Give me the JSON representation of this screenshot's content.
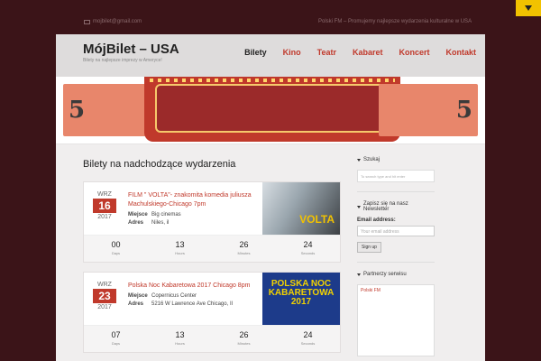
{
  "topbar": {
    "email": "mojbilet@gmail.com",
    "tagline": "Polski FM – Promujemy najlepsze wydarzenia kulturalne w USA"
  },
  "site": {
    "title": "MójBilet – USA",
    "description": "Bilety na najlepsze imprezy w Ameryce!"
  },
  "nav": {
    "items": [
      "Bilety",
      "Kino",
      "Teatr",
      "Kabaret",
      "Koncert",
      "Kontakt"
    ],
    "active": "Bilety"
  },
  "banner": {
    "ticket_left": "5",
    "ticket_right": "5"
  },
  "main": {
    "section_title": "Bilety na nadchodzące wydarzenia",
    "events": [
      {
        "month": "WRZ",
        "day": "16",
        "year": "2017",
        "title": "FILM \" VOLTA\"- znakomita komedia juliusza Machulskiego-Chicago 7pm",
        "place_label": "Miejsce",
        "place": "Big cinemas",
        "address_label": "Adres",
        "address": "Niles, il",
        "image_text": "VOLTA",
        "countdown": [
          {
            "value": "00",
            "label": "Days"
          },
          {
            "value": "13",
            "label": "Hours"
          },
          {
            "value": "26",
            "label": "Minutes"
          },
          {
            "value": "24",
            "label": "Seconds"
          }
        ]
      },
      {
        "month": "WRZ",
        "day": "23",
        "year": "2017",
        "title": "Polska Noc Kabaretowa 2017 Chicago 8pm",
        "place_label": "Miejsce",
        "place": "Copernicus Center",
        "address_label": "Adres",
        "address": "5216 W Lawrence Ave Chicago, Il",
        "image_text": "POLSKA NOC KABARETOWA 2017",
        "countdown": [
          {
            "value": "07",
            "label": "Days"
          },
          {
            "value": "13",
            "label": "Hours"
          },
          {
            "value": "26",
            "label": "Minutes"
          },
          {
            "value": "24",
            "label": "Seconds"
          }
        ]
      }
    ]
  },
  "sidebar": {
    "search_title": "Szukaj",
    "search_placeholder": "To search type and hit enter",
    "newsletter_title": "Zapisz się na nasz Newsletter",
    "email_label": "Email address:",
    "email_placeholder": "Your email address",
    "signup_label": "Sign up",
    "partners_title": "Partnerzy serwisu",
    "partner_link": "Polski FM"
  },
  "colors": {
    "accent": "#c0392b",
    "page_bg": "#3b1418",
    "toggle": "#f2c200"
  }
}
